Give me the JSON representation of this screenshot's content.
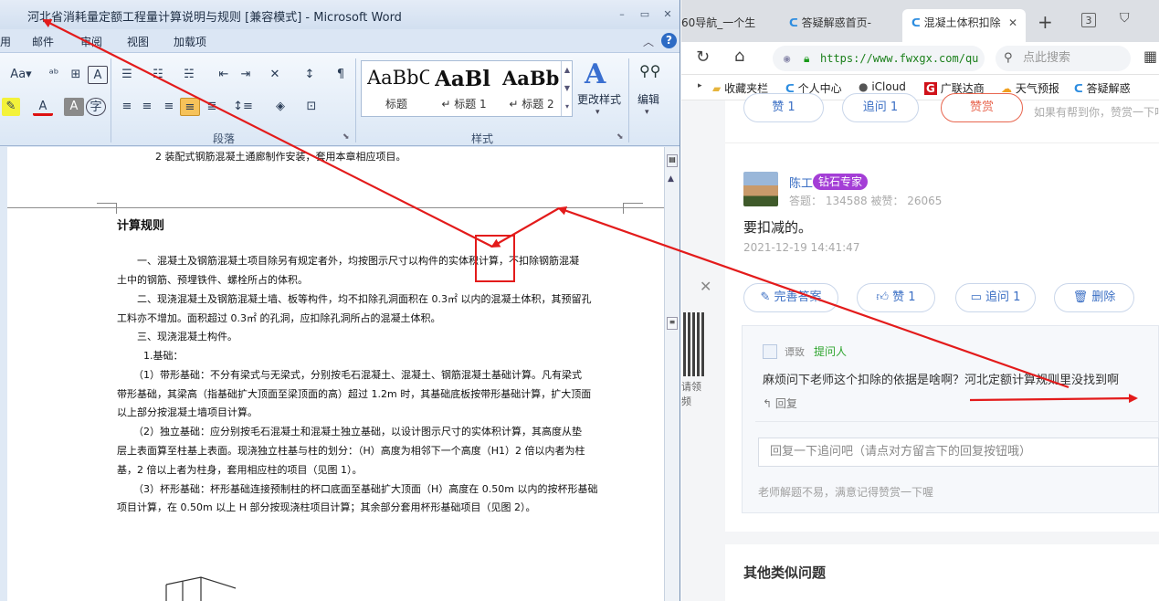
{
  "word": {
    "title": "河北省消耗量定额工程量计算说明与规则 [兼容模式] - Microsoft Word",
    "window_controls": {
      "minimize": "–",
      "restore": "▭",
      "close": "✕"
    },
    "menu_tabs": [
      "用",
      "邮件",
      "审阅",
      "视图",
      "加载项"
    ],
    "ribbon": {
      "font_size_label": "Aa▾",
      "paragraph_group_label": "段落",
      "styles_group_label": "样式",
      "styles": [
        {
          "sample": "AaBbC",
          "name": "标题"
        },
        {
          "sample": "AaBl",
          "name": "↵ 标题 1"
        },
        {
          "sample": "AaBb",
          "name": "↵ 标题 2"
        }
      ],
      "change_styles_label": "更改样式",
      "edit_label": "编辑"
    },
    "doc": {
      "prev_page_line": "2 装配式钢筋混凝土通廊制作安装，套用本章相应项目。",
      "heading": "计算规则",
      "lines": [
        "一、混凝土及钢筋混凝土项目除另有规定者外，均按图示尺寸以构件的实体积计算，不扣除钢筋混凝",
        "土中的钢筋、预埋铁件、螺栓所占的体积。",
        "二、现浇混凝土及钢筋混凝土墙、板等构件，均不扣除孔洞面积在 0.3㎡ 以内的混凝土体积，其预留孔",
        "工料亦不增加。面积超过 0.3㎡ 的孔洞，应扣除孔洞所占的混凝土体积。",
        "三、现浇混凝土构件。",
        "1.基础：",
        "（1）带形基础：不分有梁式与无梁式，分别按毛石混凝土、混凝土、钢筋混凝土基础计算。凡有梁式",
        "带形基础，其梁高（指基础扩大顶面至梁顶面的高）超过 1.2m 时，其基础底板按带形基础计算，扩大顶面",
        "以上部分按混凝土墙项目计算。",
        "（2）独立基础：应分别按毛石混凝土和混凝土独立基础，以设计图示尺寸的实体积计算，其高度从垫",
        "层上表面算至柱基上表面。现浇独立柱基与柱的划分：（H）高度为相邻下一个高度（H1）2 倍以内者为柱",
        "基，2 倍以上者为柱身，套用相应柱的项目（见图 1）。",
        "（3）杯形基础：杯形基础连接预制柱的杯口底面至基础扩大顶面（H）高度在 0.50m 以内的按杯形基础",
        "项目计算，在 0.50m 以上 H 部分按现浇柱项目计算；其余部分套用杯形基础项目（见图 2）。"
      ]
    }
  },
  "browser": {
    "tabs": [
      {
        "label": "60导航_一个生"
      },
      {
        "label": "答疑解惑首页-"
      },
      {
        "label": "混凝土体积扣除",
        "close": "✕"
      }
    ],
    "new_tab": "+",
    "tab_count": "3",
    "url_host": "https://www.fwxgx.com/qu",
    "search_placeholder": "点此搜索",
    "bookmarks": [
      "收藏夹栏",
      "个人中心",
      "iCloud",
      "广联达商",
      "天气预报",
      "答疑解惑"
    ],
    "top_actions": {
      "like": "赞 1",
      "followup": "追问 1",
      "reward": "赞赏",
      "reward_hint": "如果有帮到你，赞赏一下吧"
    },
    "answer": {
      "author": "陈工",
      "badge": "钻石专家",
      "stats": "答题： 134588    被赞： 26065",
      "content": "要扣减的。",
      "time": "2021-12-19 14:41:47"
    },
    "answer_actions": {
      "improve": "完善答案",
      "like": "赞 1",
      "followup": "追问 1",
      "delete": "删除"
    },
    "followup": {
      "user": "谭致",
      "role": "提问人",
      "content": "麻烦问下老师这个扣除的依据是啥啊？河北定额计算规则里没找到啊",
      "reply_link": "回复",
      "reply_placeholder": "回复一下追问吧（请点对方留言下的回复按钮哦）",
      "tip": "老师解题不易，满意记得赞赏一下喔"
    },
    "qr_caption": "请领\n频",
    "similar_title": "其他类似问题"
  }
}
